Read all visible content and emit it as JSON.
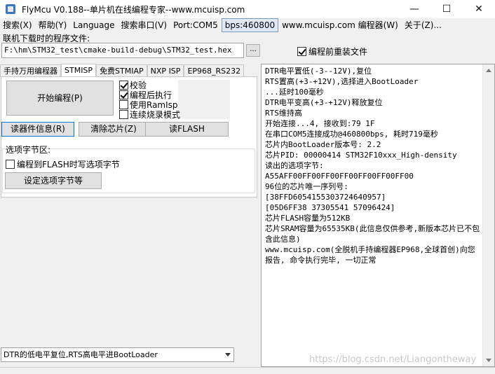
{
  "window": {
    "title": "FlyMcu V0.188--单片机在线编程专家--www.mcuisp.com",
    "minimize": "—",
    "maximize": "☐",
    "close": "✕"
  },
  "menu": [
    "搜索(X)",
    "帮助(Y)",
    "Language",
    "搜索串口(V)",
    "Port:COM5",
    "bps:460800",
    "www.mcuisp.com 编程器(W)",
    "关于(Z)..."
  ],
  "file": {
    "label": "联机下载时的程序文件:",
    "path": "F:\\hm\\STM32_test\\cmake-build-debug\\STM32_test.hex",
    "browse": "...",
    "reload_label": "编程前重装文件"
  },
  "tabs": [
    "手持万用编程器",
    "STMISP",
    "免费STMIAP",
    "NXP ISP",
    "EP968_RS232"
  ],
  "actions": {
    "start": "开始编程(P)",
    "read_info": "读器件信息(R)",
    "erase": "清除芯片(Z)",
    "read_flash": "读FLASH",
    "set_option": "设定选项字节等"
  },
  "options": {
    "verify": "校验",
    "run_after": "编程后执行",
    "use_ramisp": "使用RamIsp",
    "continuous": "连续烧录模式"
  },
  "option_bytes": {
    "label": "选项字节区:",
    "write_flash": "编程到FLASH时写选项字节"
  },
  "dtr_mode": "DTR的低电平复位,RTS高电平进BootLoader",
  "log": [
    "DTR电平置低(-3--12V),复位",
    "RTS置高(+3-+12V),选择进入BootLoader",
    "...延时100毫秒",
    "DTR电平变高(+3-+12V)释放复位",
    "RTS维持高",
    "开始连接...4, 接收到:79 1F",
    "在串口COM5连接成功@460800bps, 耗时719毫秒",
    "芯片内BootLoader版本号: 2.2",
    "芯片PID: 00000414  STM32F10xxx_High-density",
    "读出的选项字节:",
    "A55AFF00FF00FF00FF00FF00FF00FF00",
    "96位的芯片唯一序列号:",
    "[38FFD6054155303724640957]",
    "[05D6FF38 37305541 57096424]",
    "芯片FLASH容量为512KB",
    "芯片SRAM容量为65535KB(此信息仅供参考,新版本芯片已不包含此信息)",
    "www.mcuisp.com(全脱机手持编程器EP968,全球首创)向您报告, 命令执行完毕, 一切正常"
  ],
  "watermark": "https://blog.csdn.net/Liangontheway"
}
